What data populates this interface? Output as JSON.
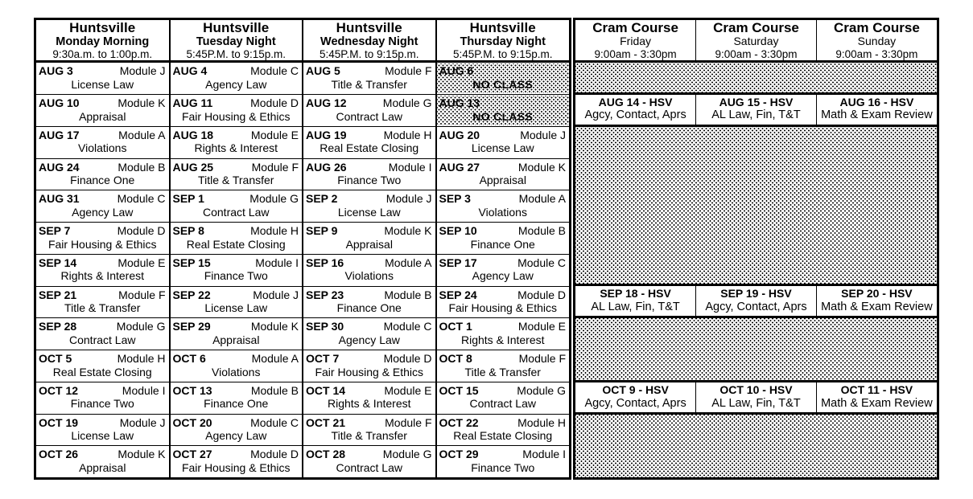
{
  "weekday_table": {
    "columns": [
      {
        "city": "Huntsville",
        "day": "Monday Morning",
        "time": "9:30a.m. to 1:00p.m."
      },
      {
        "city": "Huntsville",
        "day": "Tuesday Night",
        "time": "5:45P.M. to 9:15p.m."
      },
      {
        "city": "Huntsville",
        "day": "Wednesday Night",
        "time": "5:45P.M. to 9:15p.m."
      },
      {
        "city": "Huntsville",
        "day": "Thursday  Night",
        "time": "5:45P.M. to 9:15p.m."
      }
    ],
    "rows": [
      [
        {
          "date": "AUG 3",
          "module": "Module J",
          "subject": "License Law",
          "no_class": false
        },
        {
          "date": "AUG 4",
          "module": "Module C",
          "subject": "Agency Law",
          "no_class": false
        },
        {
          "date": "AUG 5",
          "module": "Module F",
          "subject": "Title & Transfer",
          "no_class": false
        },
        {
          "date": "AUG 6",
          "module": "",
          "subject": "NO CLASS",
          "no_class": true
        }
      ],
      [
        {
          "date": "AUG 10",
          "module": "Module K",
          "subject": "Appraisal",
          "no_class": false
        },
        {
          "date": "AUG 11",
          "module": "Module D",
          "subject": "Fair Housing & Ethics",
          "no_class": false
        },
        {
          "date": "AUG 12",
          "module": "Module G",
          "subject": "Contract Law",
          "no_class": false
        },
        {
          "date": "AUG 13",
          "module": "",
          "subject": "NO CLASS",
          "no_class": true
        }
      ],
      [
        {
          "date": "AUG 17",
          "module": "Module A",
          "subject": "Violations",
          "no_class": false
        },
        {
          "date": "AUG 18",
          "module": "Module E",
          "subject": "Rights & Interest",
          "no_class": false
        },
        {
          "date": "AUG 19",
          "module": "Module H",
          "subject": "Real Estate Closing",
          "no_class": false
        },
        {
          "date": "AUG 20",
          "module": "Module J",
          "subject": "License Law",
          "no_class": false
        }
      ],
      [
        {
          "date": "AUG 24",
          "module": "Module B",
          "subject": "Finance One",
          "no_class": false
        },
        {
          "date": "AUG 25",
          "module": "Module F",
          "subject": "Title & Transfer",
          "no_class": false
        },
        {
          "date": "AUG 26",
          "module": "Module I",
          "subject": "Finance Two",
          "no_class": false
        },
        {
          "date": "AUG 27",
          "module": "Module K",
          "subject": "Appraisal",
          "no_class": false
        }
      ],
      [
        {
          "date": "AUG 31",
          "module": "Module C",
          "subject": "Agency Law",
          "no_class": false
        },
        {
          "date": "SEP 1",
          "module": "Module G",
          "subject": "Contract Law",
          "no_class": false
        },
        {
          "date": "SEP 2",
          "module": "Module J",
          "subject": "License Law",
          "no_class": false
        },
        {
          "date": "SEP 3",
          "module": "Module A",
          "subject": "Violations",
          "no_class": false
        }
      ],
      [
        {
          "date": "SEP 7",
          "module": "Module D",
          "subject": "Fair Housing & Ethics",
          "no_class": false
        },
        {
          "date": "SEP 8",
          "module": "Module H",
          "subject": "Real Estate Closing",
          "no_class": false
        },
        {
          "date": "SEP 9",
          "module": "Module K",
          "subject": "Appraisal",
          "no_class": false
        },
        {
          "date": "SEP 10",
          "module": "Module B",
          "subject": "Finance One",
          "no_class": false
        }
      ],
      [
        {
          "date": "SEP 14",
          "module": "Module E",
          "subject": "Rights & Interest",
          "no_class": false
        },
        {
          "date": "SEP 15",
          "module": "Module I",
          "subject": "Finance Two",
          "no_class": false
        },
        {
          "date": "SEP 16",
          "module": "Module A",
          "subject": "Violations",
          "no_class": false
        },
        {
          "date": "SEP 17",
          "module": "Module C",
          "subject": "Agency Law",
          "no_class": false
        }
      ],
      [
        {
          "date": "SEP 21",
          "module": "Module F",
          "subject": "Title & Transfer",
          "no_class": false
        },
        {
          "date": "SEP 22",
          "module": "Module J",
          "subject": "License Law",
          "no_class": false
        },
        {
          "date": "SEP 23",
          "module": "Module B",
          "subject": "Finance One",
          "no_class": false
        },
        {
          "date": "SEP 24",
          "module": "Module D",
          "subject": "Fair Housing & Ethics",
          "no_class": false
        }
      ],
      [
        {
          "date": "SEP 28",
          "module": "Module G",
          "subject": "Contract Law",
          "no_class": false
        },
        {
          "date": "SEP 29",
          "module": "Module K",
          "subject": "Appraisal",
          "no_class": false
        },
        {
          "date": "SEP 30",
          "module": "Module C",
          "subject": "Agency Law",
          "no_class": false
        },
        {
          "date": "OCT 1",
          "module": "Module E",
          "subject": "Rights & Interest",
          "no_class": false
        }
      ],
      [
        {
          "date": "OCT 5",
          "module": "Module H",
          "subject": "Real Estate Closing",
          "no_class": false
        },
        {
          "date": "OCT 6",
          "module": "Module A",
          "subject": "Violations",
          "no_class": false
        },
        {
          "date": "OCT 7",
          "module": "Module D",
          "subject": "Fair Housing & Ethics",
          "no_class": false
        },
        {
          "date": "OCT 8",
          "module": "Module F",
          "subject": "Title & Transfer",
          "no_class": false
        }
      ],
      [
        {
          "date": "OCT 12",
          "module": "Module I",
          "subject": "Finance Two",
          "no_class": false
        },
        {
          "date": "OCT 13",
          "module": "Module B",
          "subject": "Finance One",
          "no_class": false
        },
        {
          "date": "OCT 14",
          "module": "Module E",
          "subject": "Rights & Interest",
          "no_class": false
        },
        {
          "date": "OCT 15",
          "module": "Module G",
          "subject": "Contract Law",
          "no_class": false
        }
      ],
      [
        {
          "date": "OCT 19",
          "module": "Module J",
          "subject": "License Law",
          "no_class": false
        },
        {
          "date": "OCT 20",
          "module": "Module C",
          "subject": "Agency Law",
          "no_class": false
        },
        {
          "date": "OCT 21",
          "module": "Module F",
          "subject": "Title & Transfer",
          "no_class": false
        },
        {
          "date": "OCT 22",
          "module": "Module H",
          "subject": "Real Estate Closing",
          "no_class": false
        }
      ],
      [
        {
          "date": "OCT 26",
          "module": "Module K",
          "subject": "Appraisal",
          "no_class": false
        },
        {
          "date": "OCT 27",
          "module": "Module D",
          "subject": "Fair Housing & Ethics",
          "no_class": false
        },
        {
          "date": "OCT 28",
          "module": "Module G",
          "subject": "Contract Law",
          "no_class": false
        },
        {
          "date": "OCT 29",
          "module": "Module I",
          "subject": "Finance Two",
          "no_class": false
        }
      ]
    ]
  },
  "cram_table": {
    "columns": [
      {
        "title": "Cram Course",
        "dow": "Friday",
        "time": "9:00am - 3:30pm"
      },
      {
        "title": "Cram Course",
        "dow": "Saturday",
        "time": "9:00am - 3:30pm"
      },
      {
        "title": "Cram Course",
        "dow": "Sunday",
        "time": "9:00am - 3:30pm"
      }
    ],
    "rows": [
      {
        "kind": "blank",
        "span": 1,
        "cells": []
      },
      {
        "kind": "session",
        "span": 1,
        "cells": [
          {
            "date": "AUG 14 - HSV",
            "topic": "Agcy, Contact, Aprs"
          },
          {
            "date": "AUG 15  - HSV",
            "topic": "AL Law, Fin, T&T"
          },
          {
            "date": "AUG 16 - HSV",
            "topic": "Math & Exam Review"
          }
        ]
      },
      {
        "kind": "blank",
        "span": 5,
        "cells": []
      },
      {
        "kind": "session",
        "span": 1,
        "cells": [
          {
            "date": "SEP 18 - HSV",
            "topic": "AL Law, Fin, T&T"
          },
          {
            "date": "SEP 19 - HSV",
            "topic": "Agcy, Contact, Aprs"
          },
          {
            "date": "SEP 20 - HSV",
            "topic": "Math & Exam Review"
          }
        ]
      },
      {
        "kind": "blank",
        "span": 2,
        "cells": []
      },
      {
        "kind": "session",
        "span": 1,
        "cells": [
          {
            "date": "OCT 9 - HSV",
            "topic": "Agcy, Contact, Aprs"
          },
          {
            "date": "OCT 10  - HSV",
            "topic": "AL Law, Fin, T&T"
          },
          {
            "date": "OCT 11 - HSV",
            "topic": "Math & Exam Review"
          }
        ]
      },
      {
        "kind": "blank",
        "span": 4,
        "cells": []
      }
    ]
  },
  "colors": {
    "ink": "#000000",
    "paper": "#ffffff"
  }
}
